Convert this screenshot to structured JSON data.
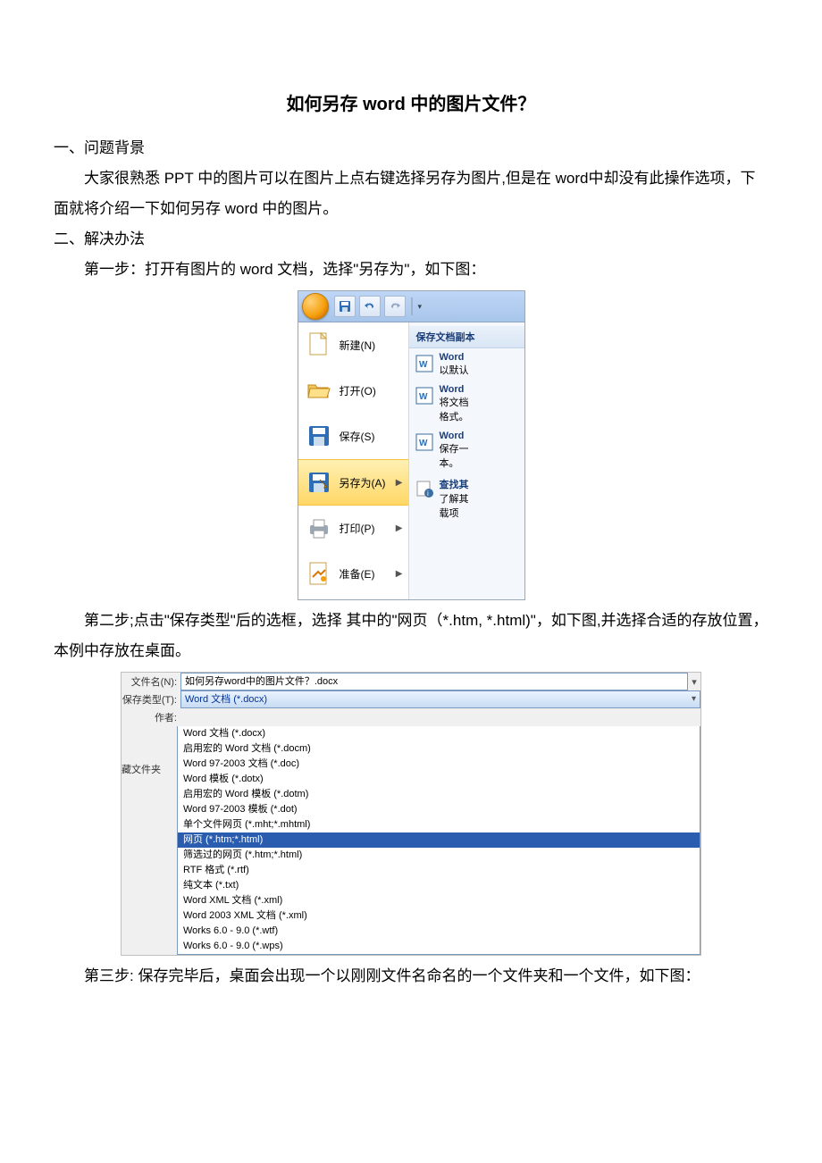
{
  "title": "如何另存 word 中的图片文件？",
  "section1": "一、问题背景",
  "para1": "大家很熟悉 PPT 中的图片可以在图片上点右键选择另存为图片,但是在 word中却没有此操作选项，下面就将介绍一下如何另存 word 中的图片。",
  "section2": "二、解决办法",
  "step1": "第一步：打开有图片的 word 文档，选择\"另存为\"，如下图：",
  "wordmenu": {
    "right_header": "保存文档副本",
    "items": {
      "new": "新建(N)",
      "open": "打开(O)",
      "save": "保存(S)",
      "saveas": "另存为(A)",
      "print": "打印(P)",
      "prepare": "准备(E)"
    },
    "right": {
      "r1_t": "Word",
      "r1_d": "以默认",
      "r2_t": "Word",
      "r2_d1": "将文档",
      "r2_d2": "格式。",
      "r3_t": "Word",
      "r3_d1": "保存一",
      "r3_d2": "本。",
      "r4_t": "查找其",
      "r4_d1": "了解其",
      "r4_d2": "载项"
    }
  },
  "step2": "第二步;点击\"保存类型\"后的选框，选择 其中的\"网页（*.htm, *.html)\"，如下图,并选择合适的存放位置，本例中存放在桌面。",
  "savedlg": {
    "filename_label": "文件名(N):",
    "filename_value": "如何另存word中的图片文件？.docx",
    "type_label": "保存类型(T):",
    "type_value": "Word 文档 (*.docx)",
    "author_label": "作者:",
    "folder_label": "藏文件夹",
    "options": [
      "Word 文档 (*.docx)",
      "启用宏的 Word 文档 (*.docm)",
      "Word 97-2003 文档 (*.doc)",
      "Word 模板 (*.dotx)",
      "启用宏的 Word 模板 (*.dotm)",
      "Word 97-2003 模板 (*.dot)",
      "单个文件网页 (*.mht;*.mhtml)",
      "网页 (*.htm;*.html)",
      "筛选过的网页 (*.htm;*.html)",
      "RTF 格式 (*.rtf)",
      "纯文本 (*.txt)",
      "Word XML 文档 (*.xml)",
      "Word 2003 XML 文档 (*.xml)",
      "Works 6.0 - 9.0 (*.wtf)",
      "Works 6.0 - 9.0 (*.wps)"
    ],
    "selected_index": 7
  },
  "step3": "第三步: 保存完毕后，桌面会出现一个以刚刚文件名命名的一个文件夹和一个文件，如下图："
}
